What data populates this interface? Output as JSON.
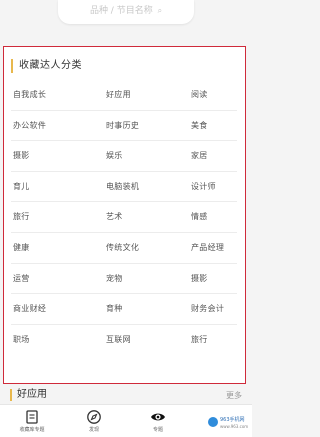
{
  "search": {
    "placeholder_text": "品种 / 节目名称",
    "icon": "search-icon"
  },
  "card": {
    "title": "收藏达人分类",
    "border_color": "#cf2a3a",
    "accent_color": "#e8b84d"
  },
  "categories": [
    [
      "自我成长",
      "好应用",
      "阅读"
    ],
    [
      "办公软件",
      "时事历史",
      "美食"
    ],
    [
      "摄影",
      "娱乐",
      "家居"
    ],
    [
      "育儿",
      "电脑装机",
      "设计师"
    ],
    [
      "旅行",
      "艺术",
      "情感"
    ],
    [
      "健康",
      "传统文化",
      "产品经理"
    ],
    [
      "运营",
      "宠物",
      "摄影"
    ],
    [
      "商业财经",
      "育种",
      "财务会计"
    ],
    [
      "职场",
      "互联网",
      "旅行"
    ]
  ],
  "section2": {
    "title": "好应用",
    "more_label": "更多"
  },
  "tabbar": {
    "tabs": [
      {
        "label": "收藏库专题",
        "icon": "book-icon"
      },
      {
        "label": "发现",
        "icon": "compass-icon"
      },
      {
        "label": "专题",
        "icon": "eye-icon"
      }
    ],
    "logo_text": "963手机网",
    "logo_sub": "www.963.com"
  }
}
